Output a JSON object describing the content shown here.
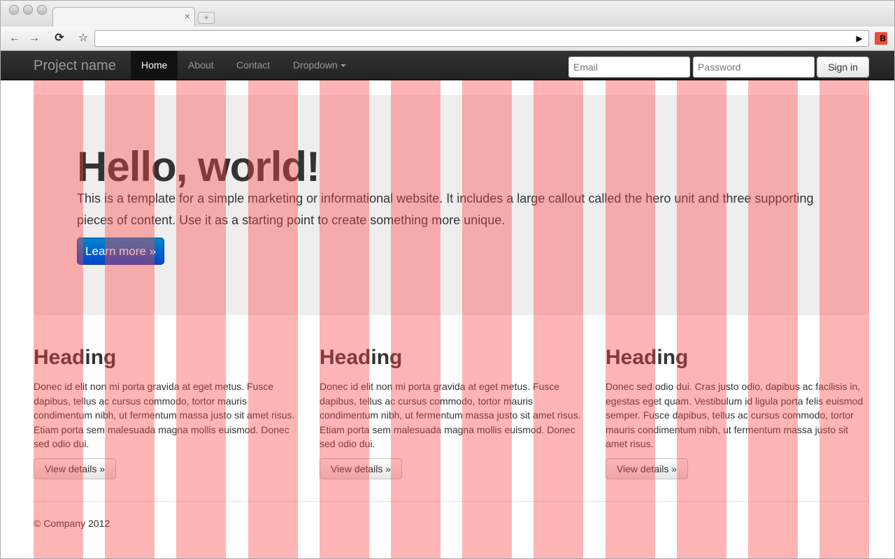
{
  "browser": {
    "tab_close": "×",
    "new_tab_glyph": "+",
    "back_glyph": "←",
    "forward_glyph": "→",
    "reload_glyph": "⟳",
    "bookmark_glyph": "☆",
    "play_glyph": "▶",
    "extension_glyph": "B",
    "address": ""
  },
  "navbar": {
    "brand": "Project name",
    "items": [
      {
        "label": "Home",
        "active": true
      },
      {
        "label": "About"
      },
      {
        "label": "Contact"
      },
      {
        "label": "Dropdown"
      }
    ],
    "email_placeholder": "Email",
    "password_placeholder": "Password",
    "signin_label": "Sign in"
  },
  "hero": {
    "title": "Hello, world!",
    "text": "This is a template for a simple marketing or informational website. It includes a large callout called the hero unit and three supporting pieces of content. Use it as a starting point to create something more unique.",
    "button": "Learn more »"
  },
  "columns": [
    {
      "heading": "Heading",
      "text": "Donec id elit non mi porta gravida at eget metus. Fusce dapibus, tellus ac cursus commodo, tortor mauris condimentum nibh, ut fermentum massa justo sit amet risus. Etiam porta sem malesuada magna mollis euismod. Donec sed odio dui.",
      "button": "View details »"
    },
    {
      "heading": "Heading",
      "text": "Donec id elit non mi porta gravida at eget metus. Fusce dapibus, tellus ac cursus commodo, tortor mauris condimentum nibh, ut fermentum massa justo sit amet risus. Etiam porta sem malesuada magna mollis euismod. Donec sed odio dui.",
      "button": "View details »"
    },
    {
      "heading": "Heading",
      "text": "Donec sed odio dui. Cras justo odio, dapibus ac facilisis in, egestas eget quam. Vestibulum id ligula porta felis euismod semper. Fusce dapibus, tellus ac cursus commodo, tortor mauris condimentum nibh, ut fermentum massa justo sit amet risus.",
      "button": "View details »"
    }
  ],
  "footer": {
    "text": "© Company 2012"
  },
  "grid_overlay": {
    "columns": 12,
    "color": "#ff4646"
  }
}
